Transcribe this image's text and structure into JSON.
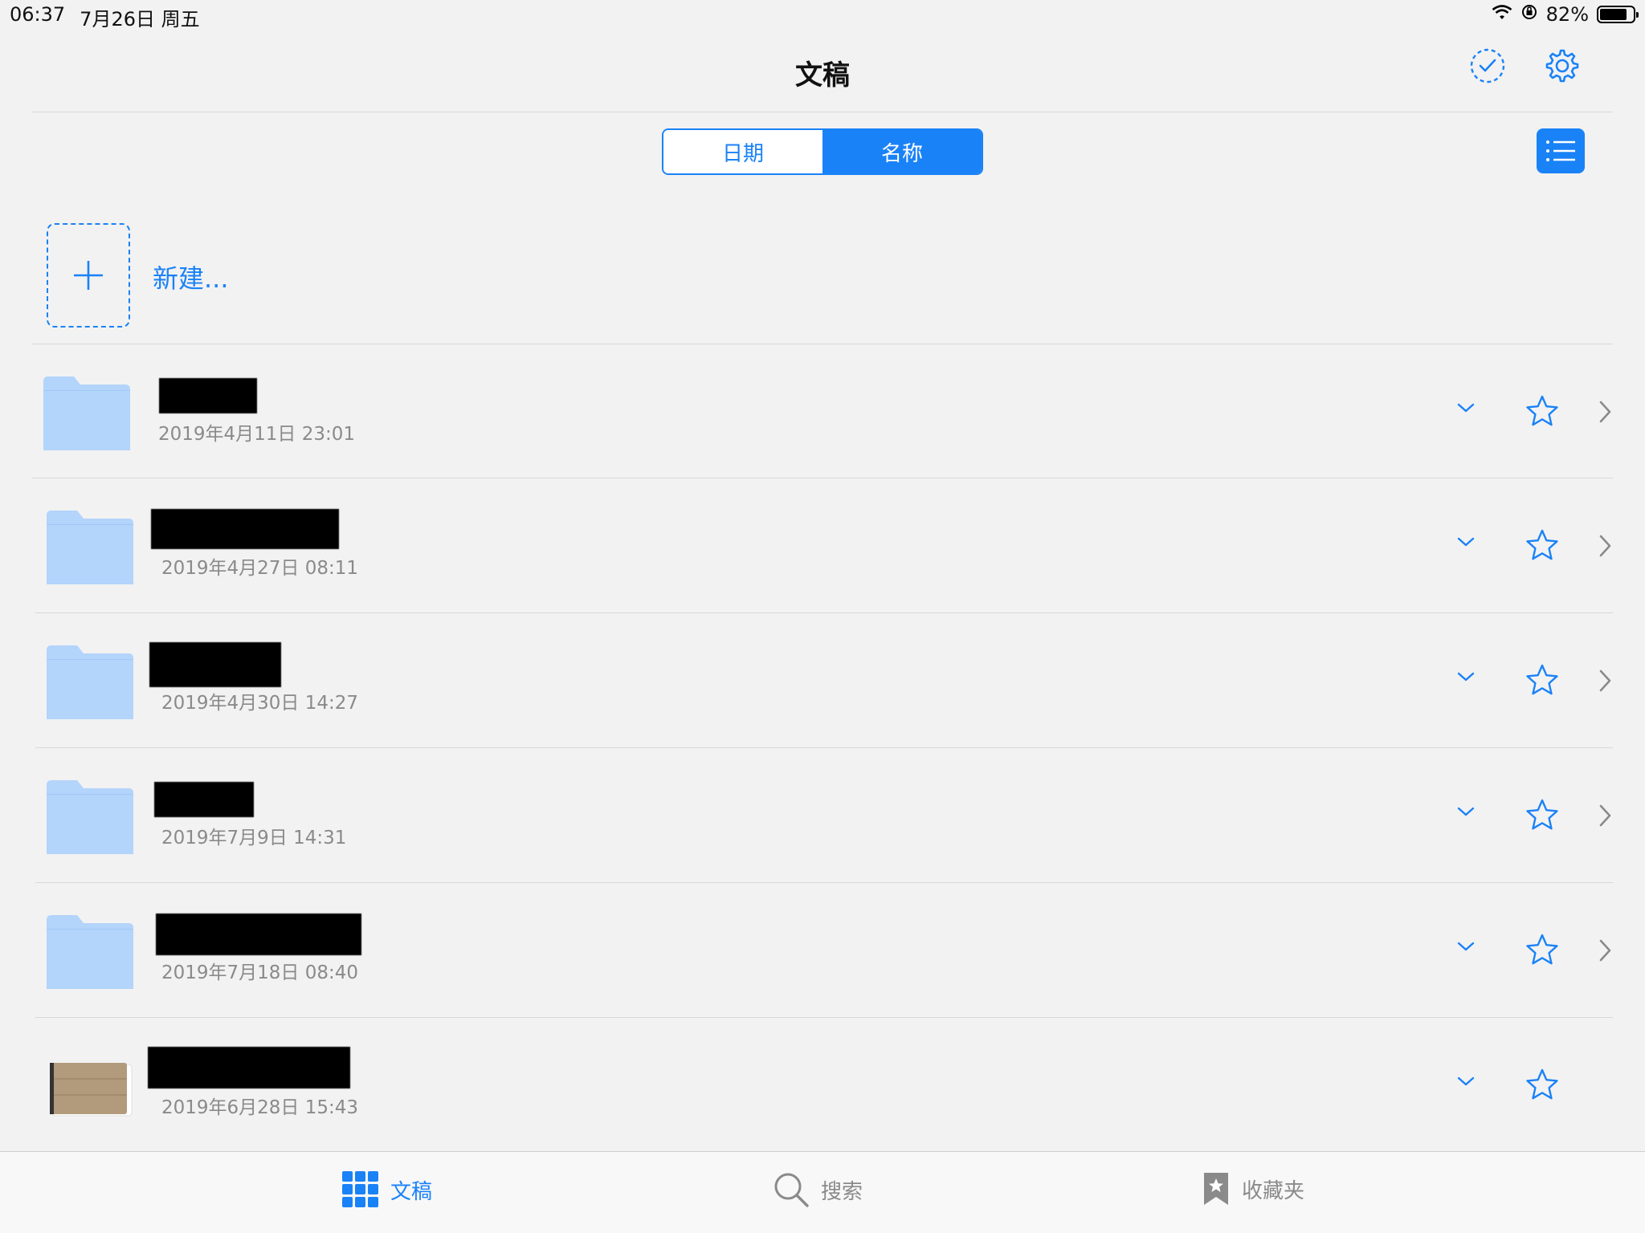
{
  "status": {
    "time": "06:37",
    "date": "7月26日 周五",
    "battery": "82%",
    "battery_level": 0.82
  },
  "nav": {
    "title": "文稿",
    "select_icon": "check-circle-dashed-icon",
    "settings_icon": "gear-icon"
  },
  "sort": {
    "options": [
      "日期",
      "名称"
    ],
    "selected": "名称"
  },
  "view_toggle_icon": "list-icon",
  "new_label": "新建...",
  "items": [
    {
      "date": "2019年4月11日 23:01",
      "type": "folder"
    },
    {
      "date": "2019年4月27日 08:11",
      "type": "folder"
    },
    {
      "date": "2019年4月30日 14:27",
      "type": "folder"
    },
    {
      "date": "2019年7月9日 14:31",
      "type": "folder"
    },
    {
      "date": "2019年7月18日 08:40",
      "type": "folder"
    },
    {
      "date": "2019年6月28日 15:43",
      "type": "notebook"
    }
  ],
  "tabs": [
    {
      "label": "文稿",
      "icon": "grid-icon",
      "active": true
    },
    {
      "label": "搜索",
      "icon": "search-icon",
      "active": false
    },
    {
      "label": "收藏夹",
      "icon": "bookmark-star-icon",
      "active": false
    }
  ],
  "colors": {
    "accent": "#1a82f7",
    "folder": "#b3d4fb",
    "background": "#f2f2f2"
  }
}
